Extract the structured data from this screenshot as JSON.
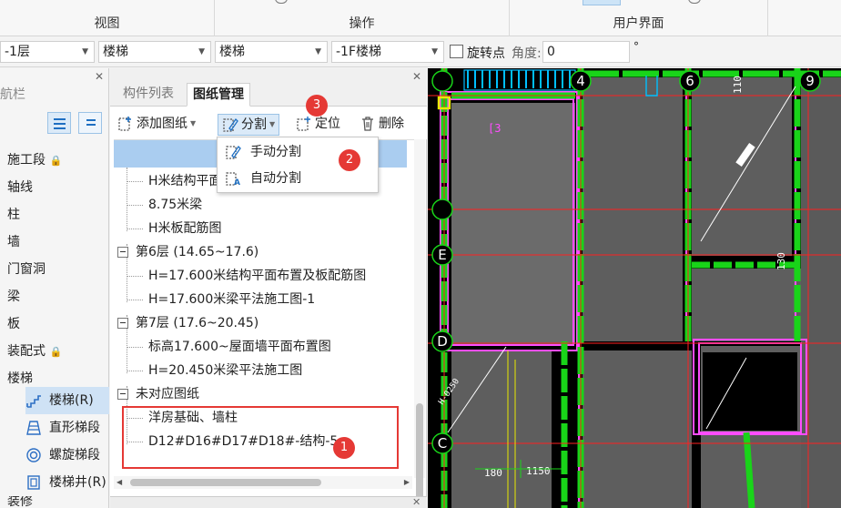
{
  "ribbon": {
    "groups": [
      {
        "label": "视图"
      },
      {
        "label": "操作"
      },
      {
        "label": "用户界面"
      }
    ]
  },
  "selectors": {
    "floor": "-1层",
    "category": "楼梯",
    "component": "楼梯",
    "instance": "-1F楼梯",
    "rotate_label": "旋转点",
    "angle_label": "角度:",
    "angle_value": "0",
    "angle_unit": "°"
  },
  "nav": {
    "title": "导航栏",
    "items": [
      {
        "label": "施工段",
        "locked": true
      },
      {
        "label": "轴线"
      },
      {
        "label": "柱"
      },
      {
        "label": "墙"
      },
      {
        "label": "门窗洞"
      },
      {
        "label": "梁"
      },
      {
        "label": "板"
      },
      {
        "label": "装配式",
        "locked": true
      },
      {
        "label": "楼梯"
      }
    ],
    "subitems": [
      {
        "label": "楼梯(R)",
        "icon": "stair-icon",
        "active": true
      },
      {
        "label": "直形梯段",
        "icon": "straight-flight-icon"
      },
      {
        "label": "螺旋梯段",
        "icon": "spiral-flight-icon"
      },
      {
        "label": "楼梯井(R)",
        "icon": "stairwell-icon"
      }
    ],
    "next_item": "装修"
  },
  "panel": {
    "tabs": [
      {
        "label": "构件列表",
        "active": false
      },
      {
        "label": "图纸管理",
        "active": true
      }
    ],
    "toolbar": {
      "add_drawing": "添加图纸",
      "split": "分割",
      "locate": "定位",
      "delete": "删除"
    },
    "tree": [
      {
        "type": "leaf",
        "label": "H米结构平面"
      },
      {
        "type": "leaf",
        "label": "8.75米梁"
      },
      {
        "type": "leaf",
        "label": "H米板配筋图"
      },
      {
        "type": "group",
        "label": "第6层 (14.65~17.6)"
      },
      {
        "type": "leaf",
        "label": "H=17.600米结构平面布置及板配筋图"
      },
      {
        "type": "leaf",
        "label": "H=17.600米梁平法施工图-1"
      },
      {
        "type": "group",
        "label": "第7层 (17.6~20.45)"
      },
      {
        "type": "leaf",
        "label": "标高17.600~屋面墙平面布置图"
      },
      {
        "type": "leaf",
        "label": "H=20.450米梁平法施工图"
      },
      {
        "type": "group",
        "label": "未对应图纸"
      },
      {
        "type": "leaf",
        "label": "洋房基础、墙柱"
      },
      {
        "type": "leaf",
        "label": "D12#D16#D17#D18#-结构-5"
      }
    ]
  },
  "split_menu": {
    "items": [
      {
        "label": "手动分割"
      },
      {
        "label": "自动分割"
      }
    ]
  },
  "markers": [
    "1",
    "2",
    "3"
  ],
  "cad": {
    "axis_labels": [
      "4",
      "6",
      "9",
      "E",
      "D",
      "C"
    ],
    "dimensions": [
      "110",
      "130",
      "180",
      "1150",
      "H-0250"
    ],
    "bracket_label": "[3"
  }
}
